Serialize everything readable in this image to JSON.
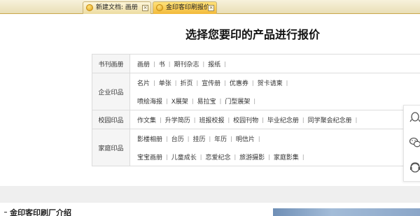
{
  "tabs": [
    {
      "label": "新建文档: 画册",
      "close": "⊠"
    },
    {
      "label": "金印客印刷报价",
      "close": "⊠"
    }
  ],
  "page_title": "选择您要印的产品进行报价",
  "categories": [
    {
      "label": "书刊画册",
      "lines": [
        [
          "画册",
          "书",
          "期刊杂志",
          "报纸"
        ]
      ]
    },
    {
      "label": "企业印品",
      "lines": [
        [
          "名片",
          "单张",
          "折页",
          "宣传册",
          "优惠券",
          "贺卡请柬"
        ],
        [
          "喷绘海报",
          "X展架",
          "易拉宝",
          "门型展架"
        ]
      ]
    },
    {
      "label": "校园印品",
      "lines": [
        [
          "作文集",
          "升学简历",
          "班报校报",
          "校园刊物",
          "毕业纪念册",
          "同学聚会纪念册"
        ]
      ]
    },
    {
      "label": "家庭印品",
      "lines": [
        [
          "影楼相册",
          "台历",
          "挂历",
          "年历",
          "明信片"
        ],
        [
          "宝宝画册",
          "儿童成长",
          "恋爱纪念",
          "旅游摄影",
          "家庭影集"
        ]
      ]
    }
  ],
  "separator": "|",
  "sidebar_icons": [
    "qq-icon",
    "wechat-icon",
    "customer-service-icon"
  ],
  "bottom_title": "金印客印刷厂介绍",
  "colors": {
    "tab_active": "#f2b93a",
    "table_border": "#dcdcdc",
    "label_bg": "#f5f5f5",
    "band": "#efefef"
  }
}
